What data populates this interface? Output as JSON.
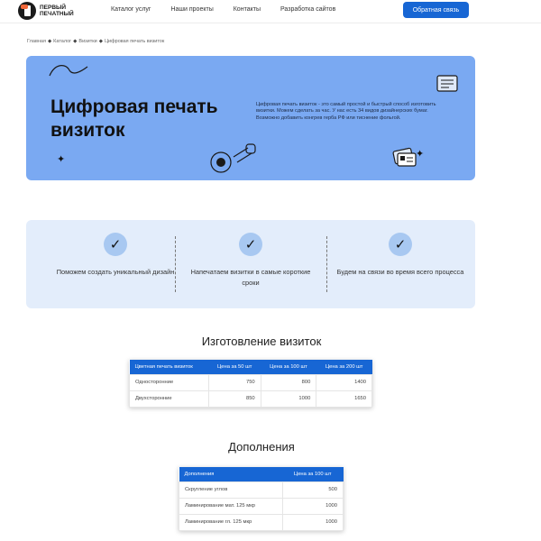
{
  "header": {
    "logo_text_line1": "ПЕРВЫЙ",
    "logo_text_line2": "ПЕЧАТНЫЙ",
    "nav": [
      "Каталог услуг",
      "Наши проекты",
      "Контакты",
      "Разработка сайтов"
    ],
    "cta_label": "Обратная связь"
  },
  "breadcrumb": [
    "Главная",
    "Каталог",
    "Визитки",
    "Цифровая печать визиток"
  ],
  "hero": {
    "title": "Цифровая печать визиток",
    "description": "Цифровая печать визиток - это самый простой и быстрый способ изготовить визитки. Можем сделать за час. У нас есть 34 видов дизайнерских бумаг. Возможно добавить конгрев герба РФ или тиснение фольгой.",
    "background": "#7aa9f2"
  },
  "features": [
    {
      "icon": "check-icon",
      "text": "Поможем создать уникальный дизайн"
    },
    {
      "icon": "check-icon",
      "text": "Напечатаем визитки в самые короткие сроки"
    },
    {
      "icon": "check-icon",
      "text": "Будем на связи во время всего процесса"
    }
  ],
  "production": {
    "title": "Изготовление визиток",
    "headers": [
      "Цветная печать визиток",
      "Цена за 50 шт",
      "Цена за 100 шт",
      "Цена за 200 шт"
    ],
    "rows": [
      [
        "Односторонние",
        "750",
        "800",
        "1400"
      ],
      [
        "Двухсторонние",
        "850",
        "1000",
        "1650"
      ]
    ]
  },
  "extras": {
    "title": "Дополнения",
    "headers": [
      "Дополнения",
      "Цена за 100 шт"
    ],
    "rows": [
      [
        "Скругление углов",
        "500"
      ],
      [
        "Ламинирование мат. 125 мкр",
        "1000"
      ],
      [
        "Ламинирование гл. 125 мкр",
        "1000"
      ]
    ]
  },
  "colors": {
    "accent": "#1766d4",
    "features_bg": "#e3edfb"
  }
}
